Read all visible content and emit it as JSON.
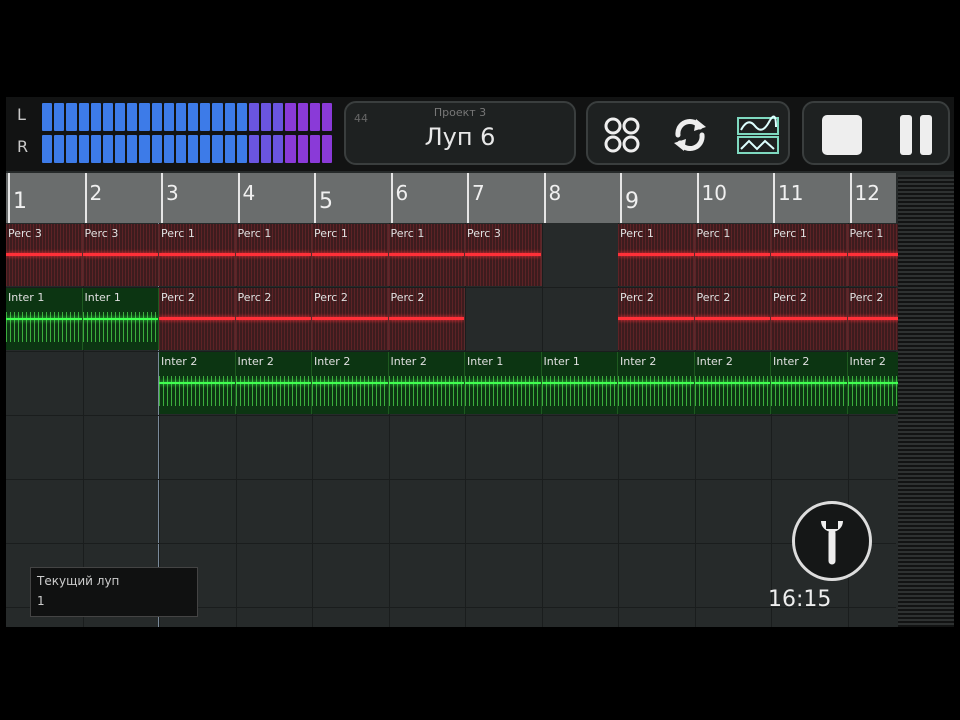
{
  "meter": {
    "left_label": "L",
    "right_label": "R",
    "segments": 24
  },
  "project": {
    "small_label": "Проект 3",
    "corner_label": "44",
    "loop_title": "Луп 6"
  },
  "icons": {
    "drum_pads": "drum-pads-icon",
    "loop_sync": "loop-sync-icon",
    "waveform": "waveform-icon",
    "stop": "stop-icon",
    "pause": "pause-icon",
    "wrench": "wrench-icon"
  },
  "ruler": {
    "bars": [
      "1",
      "2",
      "3",
      "4",
      "5",
      "6",
      "7",
      "8",
      "9",
      "10",
      "11",
      "12"
    ]
  },
  "tracks": [
    {
      "clips": [
        {
          "bar": 1,
          "label": "Perc 3",
          "kind": "perc"
        },
        {
          "bar": 2,
          "label": "Perc 3",
          "kind": "perc"
        },
        {
          "bar": 3,
          "label": "Perc 1",
          "kind": "perc"
        },
        {
          "bar": 4,
          "label": "Perc 1",
          "kind": "perc"
        },
        {
          "bar": 5,
          "label": "Perc 1",
          "kind": "perc"
        },
        {
          "bar": 6,
          "label": "Perc 1",
          "kind": "perc"
        },
        {
          "bar": 7,
          "label": "Perc 3",
          "kind": "perc"
        },
        {
          "bar": 9,
          "label": "Perc 1",
          "kind": "perc"
        },
        {
          "bar": 10,
          "label": "Perc 1",
          "kind": "perc"
        },
        {
          "bar": 11,
          "label": "Perc 1",
          "kind": "perc"
        },
        {
          "bar": 12,
          "label": "Perc 1",
          "kind": "perc"
        }
      ]
    },
    {
      "clips": [
        {
          "bar": 1,
          "label": "Inter 1",
          "kind": "inter"
        },
        {
          "bar": 2,
          "label": "Inter 1",
          "kind": "inter"
        },
        {
          "bar": 3,
          "label": "Perc 2",
          "kind": "perc"
        },
        {
          "bar": 4,
          "label": "Perc 2",
          "kind": "perc"
        },
        {
          "bar": 5,
          "label": "Perc 2",
          "kind": "perc"
        },
        {
          "bar": 6,
          "label": "Perc 2",
          "kind": "perc"
        },
        {
          "bar": 9,
          "label": "Perc 2",
          "kind": "perc"
        },
        {
          "bar": 10,
          "label": "Perc 2",
          "kind": "perc"
        },
        {
          "bar": 11,
          "label": "Perc 2",
          "kind": "perc"
        },
        {
          "bar": 12,
          "label": "Perc 2",
          "kind": "perc"
        }
      ]
    },
    {
      "clips": [
        {
          "bar": 3,
          "label": "Inter 2",
          "kind": "inter"
        },
        {
          "bar": 4,
          "label": "Inter 2",
          "kind": "inter"
        },
        {
          "bar": 5,
          "label": "Inter 2",
          "kind": "inter"
        },
        {
          "bar": 6,
          "label": "Inter 2",
          "kind": "inter"
        },
        {
          "bar": 7,
          "label": "Inter 1",
          "kind": "inter"
        },
        {
          "bar": 8,
          "label": "Inter 1",
          "kind": "inter"
        },
        {
          "bar": 9,
          "label": "Inter 2",
          "kind": "inter"
        },
        {
          "bar": 10,
          "label": "Inter 2",
          "kind": "inter"
        },
        {
          "bar": 11,
          "label": "Inter 2",
          "kind": "inter"
        },
        {
          "bar": 12,
          "label": "Inter 2",
          "kind": "inter"
        }
      ]
    },
    {
      "clips": []
    },
    {
      "clips": []
    },
    {
      "clips": []
    }
  ],
  "current_loop": {
    "label": "Текущий луп",
    "value": "1"
  },
  "clock": "16:15",
  "colors": {
    "meter": "#3d7be8",
    "meter_end": "#8a3ad8",
    "perc_wave": "#ff3038",
    "inter_wave": "#40ff50"
  }
}
